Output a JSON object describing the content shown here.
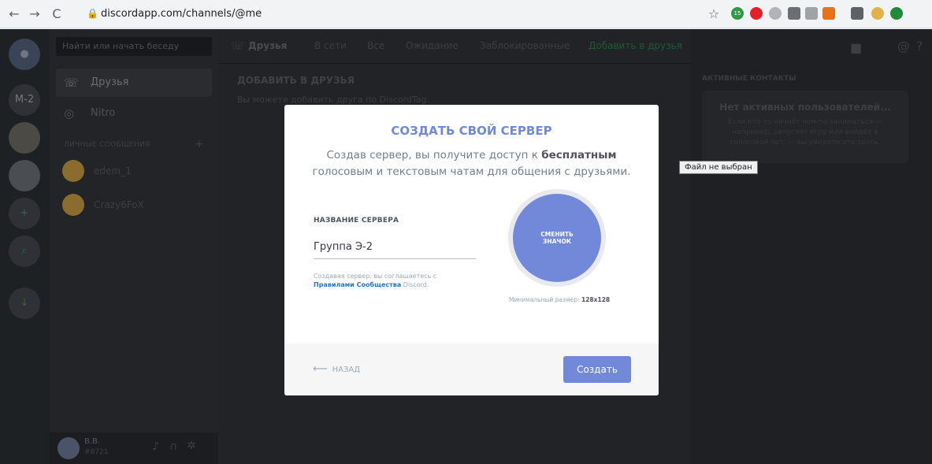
{
  "browser": {
    "url": "discordapp.com/channels/@me",
    "back": "←",
    "forward": "→",
    "reload": "C",
    "star": "☆",
    "ext_counter": "15"
  },
  "guilds": {
    "initials": "M-2"
  },
  "channels": {
    "search_placeholder": "Найти или начать беседу",
    "friends_label": "Друзья",
    "nitro_label": "Nitro",
    "dm_header": "ЛИЧНЫЕ СООБЩЕНИЯ",
    "dm_add": "+",
    "dms": [
      "edem_1",
      "Crazy6FoX"
    ],
    "user_name": "B.B.",
    "user_tag": "#8721"
  },
  "topbar": {
    "friends": "Друзья",
    "online": "В сети",
    "all": "Все",
    "pending": "Ожидание",
    "blocked": "Заблокированные",
    "add_friend": "Добавить в друзья"
  },
  "main": {
    "section_title": "ДОБАВИТЬ В ДРУЗЬЯ",
    "section_sub": "Вы можете добавить друга по DiscordTag."
  },
  "right": {
    "header": "АКТИВНЫЕ КОНТАКТЫ",
    "empty_title": "Нет активных пользователей...",
    "empty_body": "Если кто-то начнёт чем-то заниматься — например, запустит игру или войдёт в голосовой чат, — вы увидите это здесь."
  },
  "tooltip": "Файл не выбран",
  "modal": {
    "title": "СОЗДАТЬ СВОЙ СЕРВЕР",
    "desc_prefix": "Создав сервер, вы получите доступ к",
    "desc_bold": "бесплатным",
    "desc_suffix": "голосовым и текстовым чатам для общения с друзьями.",
    "name_label": "НАЗВАНИЕ СЕРВЕРА",
    "name_value": "Группа Э-2",
    "agree_prefix": "Создавая сервер, вы соглашаетесь с",
    "agree_link": "Правилами Сообщества",
    "agree_suffix": "Discord.",
    "icon_line1": "СМЕНИТЬ",
    "icon_line2": "ЗНАЧОК",
    "min_size_label": "Минимальный размер:",
    "min_size_value": "128x128",
    "back_label": "НАЗАД",
    "create_label": "Создать"
  },
  "colors": {
    "accent": "#7289da",
    "link": "#2873d3"
  }
}
